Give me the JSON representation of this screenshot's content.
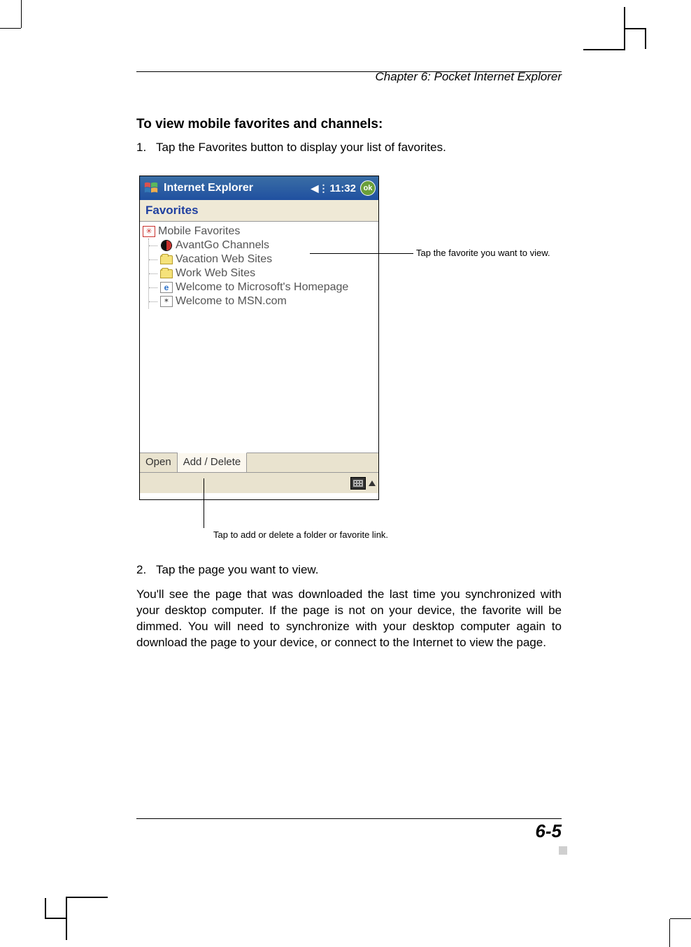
{
  "chapter_header": "Chapter 6: Pocket Internet Explorer",
  "section_heading": "To view mobile favorites and channels:",
  "steps": [
    {
      "num": "1.",
      "text": "Tap the Favorites button to display your list of favorites."
    },
    {
      "num": "2.",
      "text": "Tap the page you want to view."
    }
  ],
  "screenshot": {
    "title": "Internet Explorer",
    "clock": "11:32",
    "ok_label": "ok",
    "favorites_header": "Favorites",
    "tree_root": "Mobile Favorites",
    "tree_items": [
      {
        "icon": "avantgo",
        "label": "AvantGo Channels"
      },
      {
        "icon": "folder",
        "label": "Vacation Web Sites"
      },
      {
        "icon": "folder",
        "label": "Work Web Sites"
      },
      {
        "icon": "ie",
        "label": "Welcome to Microsoft's Homepage"
      },
      {
        "icon": "msn",
        "label": "Welcome to MSN.com"
      }
    ],
    "tabs": {
      "open": "Open",
      "add_delete": "Add / Delete"
    }
  },
  "callout_right": "Tap the favorite you want to view.",
  "callout_bottom": "Tap to add or delete a folder or favorite link.",
  "body_para": "You'll see the page that was downloaded the last time you synchronized with your desktop computer. If the page is not on your device, the favorite will be dimmed. You will need to synchronize with your desktop computer again to download the page to your device, or connect to the Internet to view the page.",
  "page_number": "6-5"
}
